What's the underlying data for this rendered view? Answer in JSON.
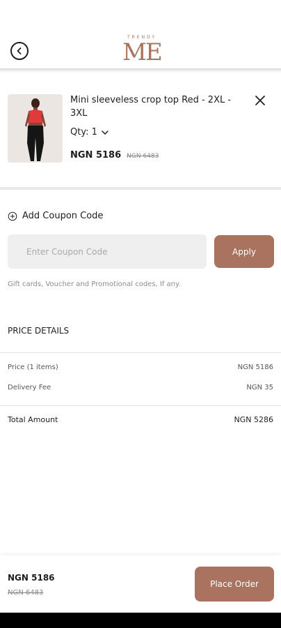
{
  "header": {
    "logo_small": "TRENDY",
    "logo_big": "ME",
    "back_icon": "chevron-left-circle-icon"
  },
  "cart_item": {
    "title": "Mini sleeveless crop top Red - 2XL - 3XL",
    "qty_label": "Qty: 1",
    "price": "NGN 5186",
    "old_price": "NGN 6483",
    "remove_icon": "close-icon"
  },
  "coupon": {
    "toggle_label": "Add Coupon Code",
    "placeholder": "Enter Coupon Code",
    "apply_label": "Apply",
    "help_text": "Gift cards, Voucher and Promotional codes, If any."
  },
  "price_details": {
    "title": "PRICE DETAILS",
    "rows": [
      {
        "label": "Price (1 items)",
        "value": "NGN 5186"
      },
      {
        "label": "Delivery Fee",
        "value": "NGN 35"
      }
    ],
    "total_label": "Total Amount",
    "total_value": "NGN 5286"
  },
  "footer": {
    "price": "NGN 5186",
    "old_price": "NGN 6483",
    "place_order_label": "Place Order"
  },
  "colors": {
    "accent": "#a9735f",
    "text": "#1e1e1e",
    "muted": "#8c8c8c"
  }
}
